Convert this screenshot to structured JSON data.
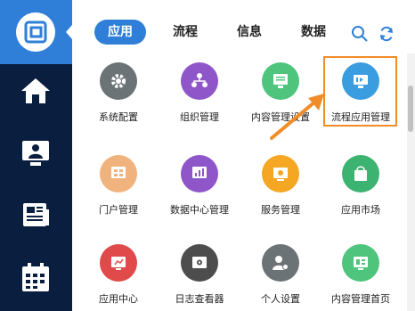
{
  "tabs": [
    {
      "label": "应用",
      "active": true
    },
    {
      "label": "流程",
      "active": false
    },
    {
      "label": "信息",
      "active": false
    },
    {
      "label": "数据",
      "active": false
    }
  ],
  "toolbar": {
    "search_icon": "search-icon",
    "refresh_icon": "refresh-icon"
  },
  "sidebar": {
    "items": [
      {
        "icon": "logo-icon"
      },
      {
        "icon": "home-icon"
      },
      {
        "icon": "user-monitor-icon"
      },
      {
        "icon": "newspaper-icon"
      },
      {
        "icon": "calendar-icon"
      }
    ]
  },
  "apps": [
    {
      "label": "系统配置",
      "color": "#6b7376",
      "icon": "gear-icon"
    },
    {
      "label": "组织管理",
      "color": "#8e56c9",
      "icon": "org-icon"
    },
    {
      "label": "内容管理设置",
      "color": "#4fc47d",
      "icon": "content-settings-icon"
    },
    {
      "label": "流程应用管理",
      "color": "#3a9de0",
      "icon": "flow-icon"
    },
    {
      "label": "门户管理",
      "color": "#f0b37e",
      "icon": "portal-icon"
    },
    {
      "label": "数据中心管理",
      "color": "#8e56c9",
      "icon": "data-center-icon"
    },
    {
      "label": "服务管理",
      "color": "#f5a623",
      "icon": "service-icon"
    },
    {
      "label": "应用市场",
      "color": "#3cb371",
      "icon": "shopping-bag-icon"
    },
    {
      "label": "应用中心",
      "color": "#e04a4a",
      "icon": "app-center-icon"
    },
    {
      "label": "日志查看器",
      "color": "#4d4d4d",
      "icon": "log-icon"
    },
    {
      "label": "个人设置",
      "color": "#6b7376",
      "icon": "person-settings-icon"
    },
    {
      "label": "内容管理首页",
      "color": "#4fc47d",
      "icon": "content-home-icon"
    }
  ],
  "colors": {
    "accent": "#2f7fd9",
    "sidebar": "#0a1f3f",
    "highlight": "#f28c28"
  }
}
